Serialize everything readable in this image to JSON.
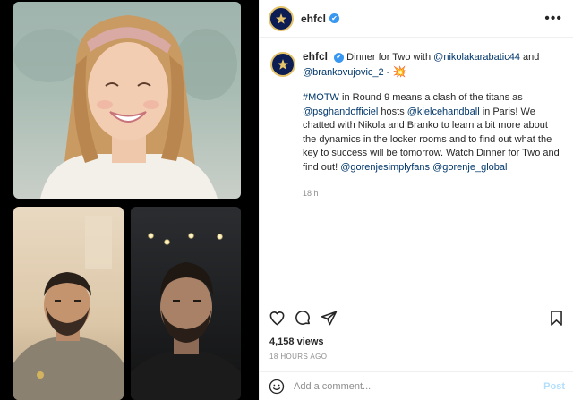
{
  "media": {
    "icons": [
      "video-call-tile-woman",
      "video-call-tile-player-left",
      "video-call-tile-player-right"
    ]
  },
  "header": {
    "username": "ehfcl",
    "verified_glyph": "✔",
    "more_glyph": "•••"
  },
  "caption": {
    "username": "ehfcl",
    "line1_text": "Dinner for Two with ",
    "mention1": "@nikolakarabatic44",
    "line1_and": " and ",
    "mention2": "@brankovujovic_2",
    "line1_dash": " - ",
    "line1_emoji": "💥",
    "hashtag": "#MOTW",
    "p2a": " in Round 9 means a clash of the titans as ",
    "mention3": "@psghandofficiel",
    "p2b": " hosts ",
    "mention4": "@kielcehandball",
    "p2c": " in Paris! We chatted with Nikola and Branko to learn a bit more about the dynamics in the locker rooms and to find out what the key to success will be tomorrow. Watch Dinner for Two and find out! ",
    "mention5": "@gorenjesimplyfans",
    "p2d": " ",
    "mention6": "@gorenje_global",
    "time": "18 h"
  },
  "actions": {
    "icons": [
      "heart-icon",
      "comment-icon",
      "share-icon",
      "bookmark-icon"
    ]
  },
  "stats": {
    "views": "4,158 views",
    "time_ago": "18 HOURS AGO"
  },
  "comment_box": {
    "placeholder": "Add a comment...",
    "post_label": "Post",
    "icon": "emoji-icon"
  },
  "colors": {
    "link": "#00376b",
    "verified": "#3897f0",
    "post_disabled": "#b2dffc",
    "avatar_bg": "#0b1d52",
    "avatar_ring": "#e4c36a"
  }
}
